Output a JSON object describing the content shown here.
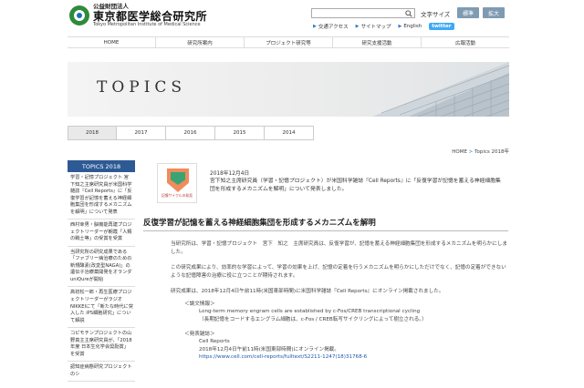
{
  "header": {
    "logo_corp": "公益財団法人",
    "logo_name": "東京都医学総合研究所",
    "logo_en": "Tokyo Metropolitan Institute of Medical Science",
    "search_placeholder": "",
    "fontsize_label": "文字サイズ",
    "fontsize_standard": "標準",
    "fontsize_large": "拡大",
    "links": [
      "交通アクセス",
      "サイトマップ",
      "English"
    ],
    "twitter_label": "twitter"
  },
  "nav": [
    "HOME",
    "研究所案内",
    "プロジェクト研究等",
    "研究支援活動",
    "広報活動"
  ],
  "banner": {
    "title": "TOPICS"
  },
  "years": [
    "2018",
    "2017",
    "2016",
    "2015",
    "2014"
  ],
  "breadcrumb": {
    "home": "HOME",
    "sep": " > ",
    "current": "Topics 2018年"
  },
  "sidebar": {
    "title": "TOPICS 2018",
    "items": [
      "学習・記憶プロジェクト 宮下知之主席研究員が米国科学雑誌『Cell Reports』に「反復学習が記憶を蓄える神経細胞集団を形成するメカニズムを解明」について発表",
      "西村幸男・脳機能再建プロジェクトリーダーが朝霞「人類の戦士等」の受賞を受賞",
      "当研究所の研究成果である「ファブリー病治療のための新規酵素(改変型NAGA)」の遺伝子治療薬開発をオランダuniQureが開始",
      "高初松一郎・再生医療プロジェクトリーダーがラジオNIKKEIにて「新たな時代に突入した iPS細胞研究」について解説",
      "コピモチンプロジェクトの山野真主主席研究員が、「2018年度 日本生化学会奨励賞」を受賞",
      "認知症病態研究プロジェクトのシ"
    ]
  },
  "entry": {
    "thumb_caption": "記憶サイクルの発見",
    "date": "2018年12月4日",
    "text": "宮下知之主席研究員（学習・記憶プロジェクト）が米国科学雑誌『Cell Reports』に「反復学習が記憶を蓄える神経細胞集団を形成するメカニズムを解明」について発表しました。"
  },
  "article": {
    "heading": "反復学習が記憶を蓄える神経細胞集団を形成するメカニズムを解明",
    "p1": "当研究所は、学習・記憶プロジェクト　宮下　知之　主席研究員は、反復学習が、記憶を蓄える神経細胞集団を形成するメカニズムを明らかにしました。",
    "p2": "この研究成果により、効率的な学習によって、学習の効果を上げ、記憶の定着を行うメカニズムを明らかにしただけでなく、記憶の定着ができないような記憶障害の治療に役に立つことが期待されます。",
    "p3": "研究成果は、2018年12月4日午前11時(米国東部時間)に米国科学雑誌『Cell Reports』にオンライン掲載されました。",
    "label1": "＜論文情報＞",
    "title_en": "Long-term memory engram cells are established by c-Fos/CREB transcriptional cycling",
    "title_ja": "（長期記憶をコードするエングラム細胞は、c-Fos / CREB転写サイクリングによって樹立される。）",
    "label2": "＜発表雑誌＞",
    "journal": "Cell Reports",
    "pub_date": "2018年12月4日午前11時(米国東部時間)にオンライン掲載。",
    "url": "https://www.cell.com/cell-reports/fulltext/S2211-1247(18)31768-6"
  },
  "colors": {
    "sidebar_title_bg": "#2d5a94",
    "link": "#1a56a8",
    "twitter": "#3fa9f5",
    "fontsize_btn": "#7f9bb2"
  }
}
